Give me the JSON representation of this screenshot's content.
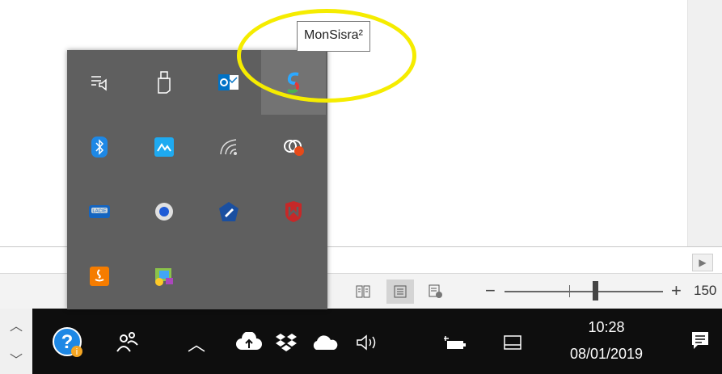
{
  "tooltip": {
    "text": "MonSisra²"
  },
  "zoom": {
    "minus": "−",
    "plus": "+",
    "percent": "150"
  },
  "clock": {
    "time": "10:28",
    "date": "08/01/2019"
  },
  "colors": {
    "annotation": "#f5ec00",
    "taskbar": "#0e0e0e",
    "popup": "#5f5f5f"
  },
  "tray_icons": [
    "playlist-audio-icon",
    "usb-drive-icon",
    "outlook-icon",
    "monsisra-icon",
    "bluetooth-icon",
    "mountain-app-icon",
    "wifi-icon",
    "cloud-sync-icon",
    "lacie-drive-icon",
    "blue-dot-icon",
    "pen-shield-icon",
    "mcafee-icon",
    "java-icon",
    "color-app-icon"
  ]
}
